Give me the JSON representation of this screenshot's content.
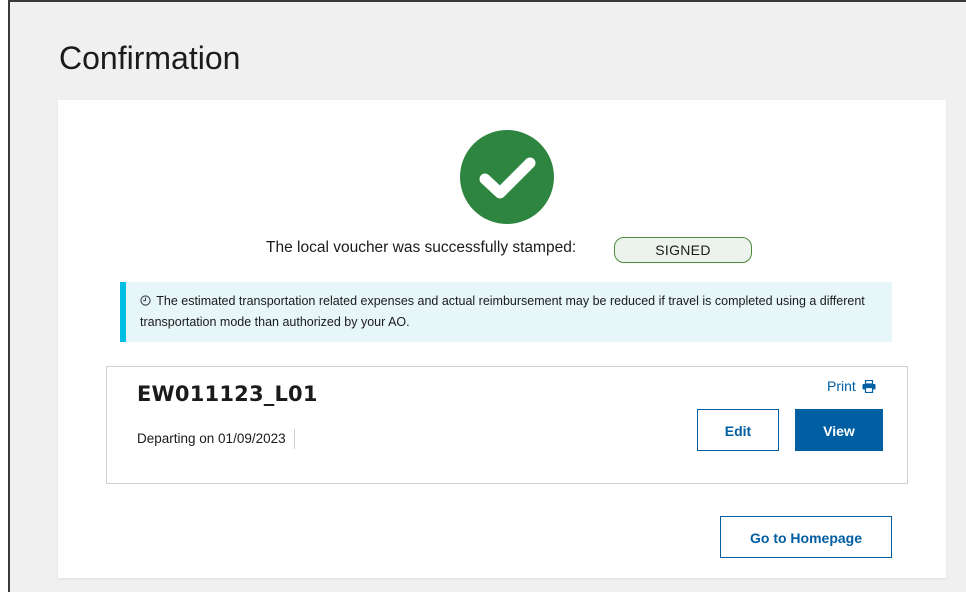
{
  "page": {
    "title": "Confirmation"
  },
  "status": {
    "message": "The local voucher was successfully stamped:",
    "badge": "SIGNED",
    "badge_color": "#4d8b3e",
    "success_icon": "check-circle-icon",
    "success_color": "#2e8540"
  },
  "alert": {
    "icon": "clock-icon",
    "text": "The estimated transportation related expenses and actual reimbursement may be reduced if travel is completed using a different transportation mode than authorized by your AO.",
    "accent_color": "#00bde3"
  },
  "voucher": {
    "id": "EW011123_L01",
    "departing": "Departing on 01/09/2023",
    "print_label": "Print",
    "print_icon": "printer-icon",
    "edit_label": "Edit",
    "view_label": "View"
  },
  "actions": {
    "home_label": "Go to Homepage"
  },
  "colors": {
    "primary": "#005ea2",
    "background": "#f0f0f0"
  }
}
